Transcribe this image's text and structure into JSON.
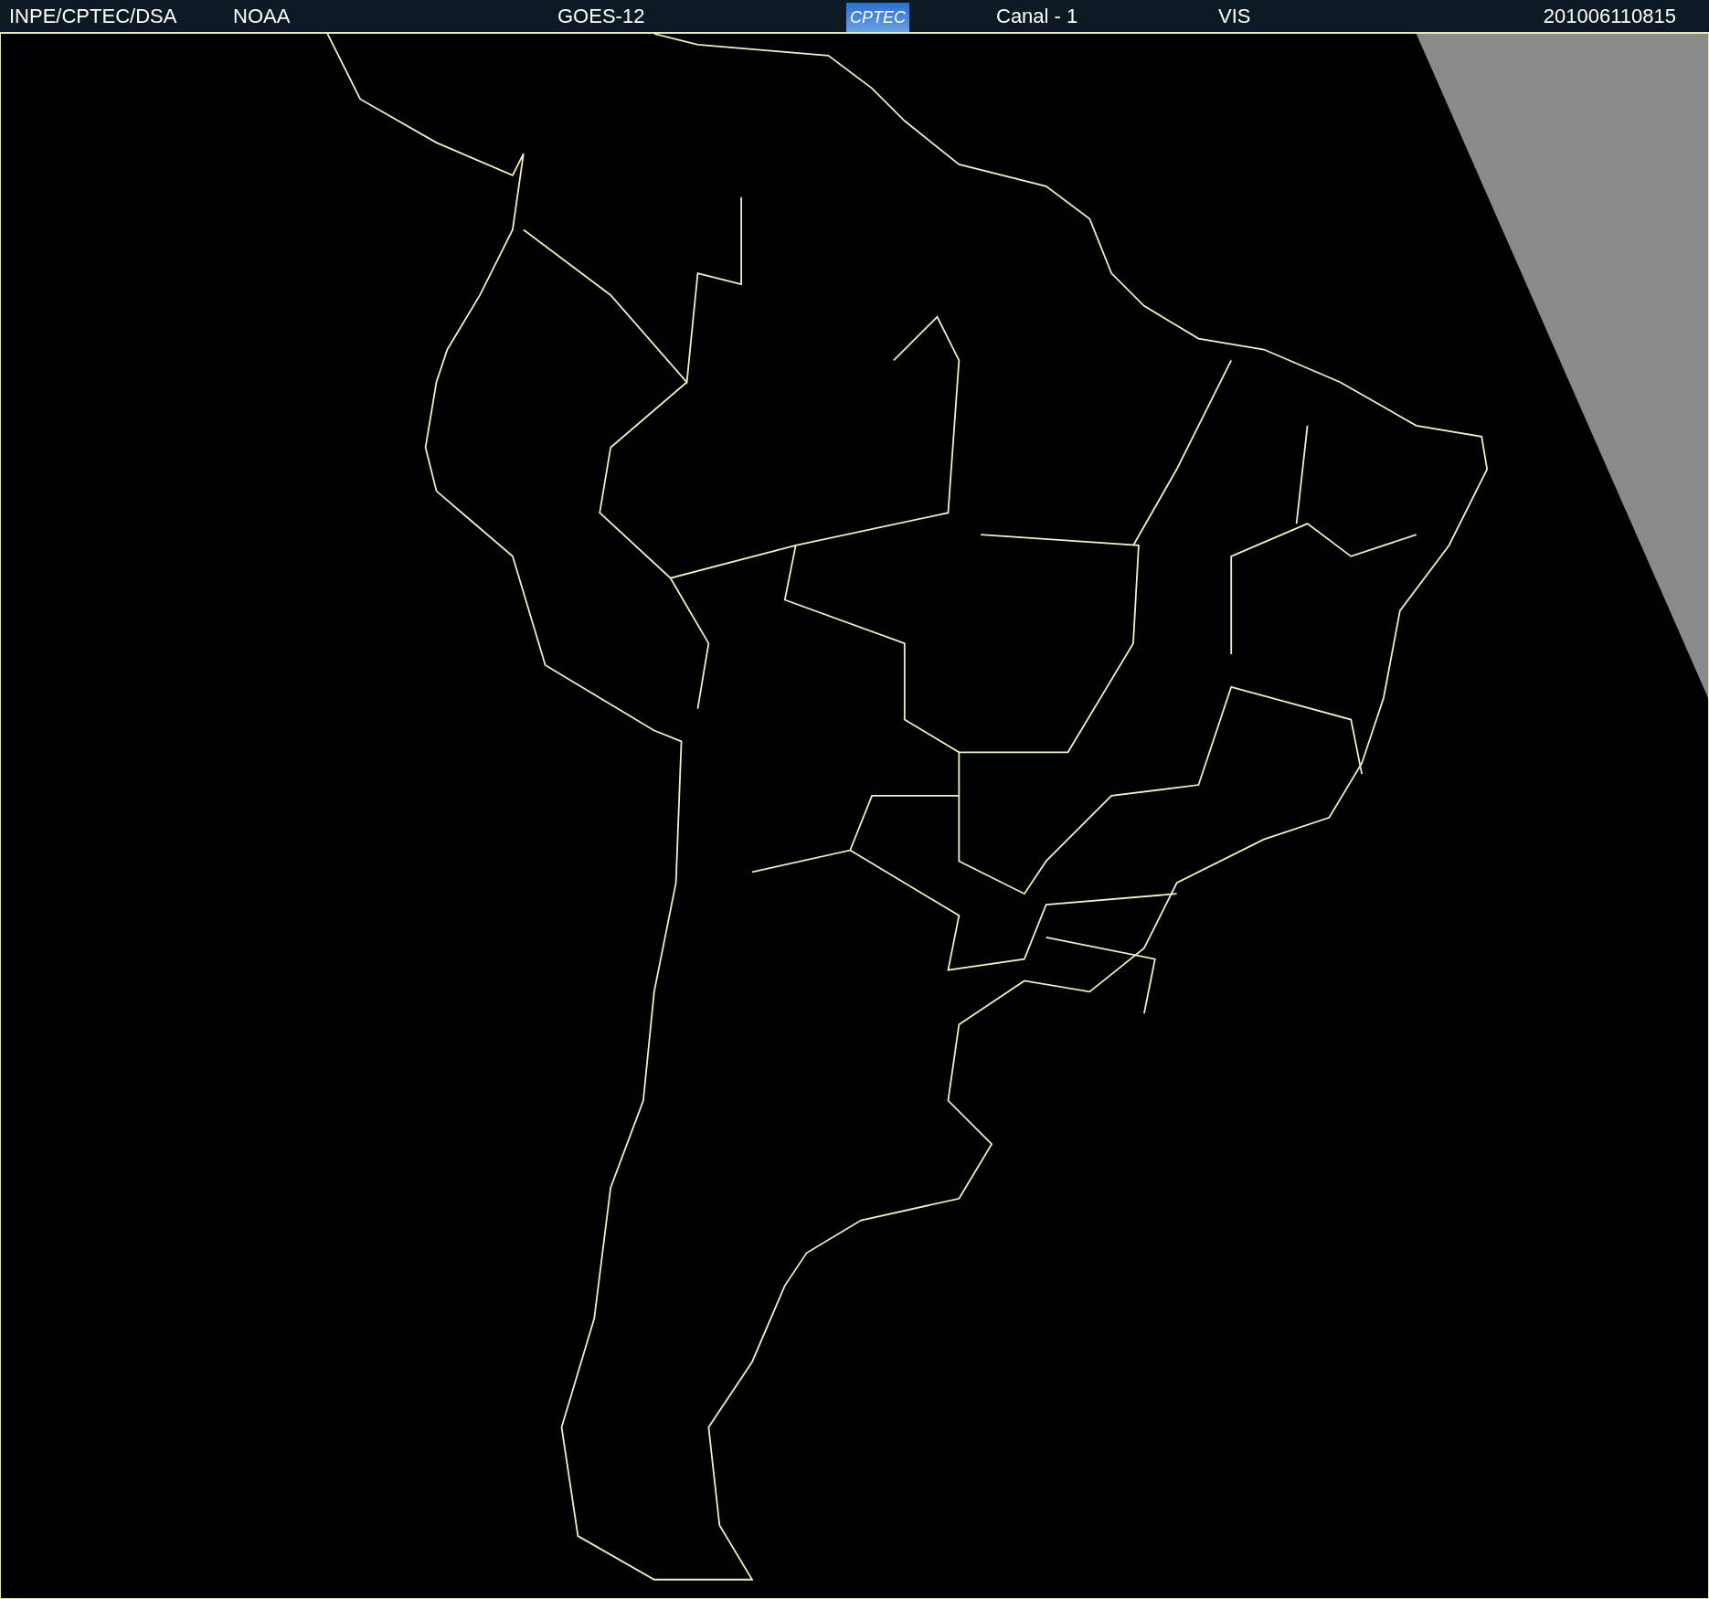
{
  "header": {
    "items": [
      {
        "kind": "text",
        "text": "INPE/CPTEC/DSA"
      },
      {
        "kind": "text",
        "text": "NOAA"
      },
      {
        "kind": "text",
        "text": "GOES-12"
      },
      {
        "kind": "logo",
        "text": "CPTEC"
      },
      {
        "kind": "text",
        "text": "Canal - 1"
      },
      {
        "kind": "text",
        "text": "VIS"
      },
      {
        "kind": "text",
        "text": "201006110815"
      }
    ]
  }
}
